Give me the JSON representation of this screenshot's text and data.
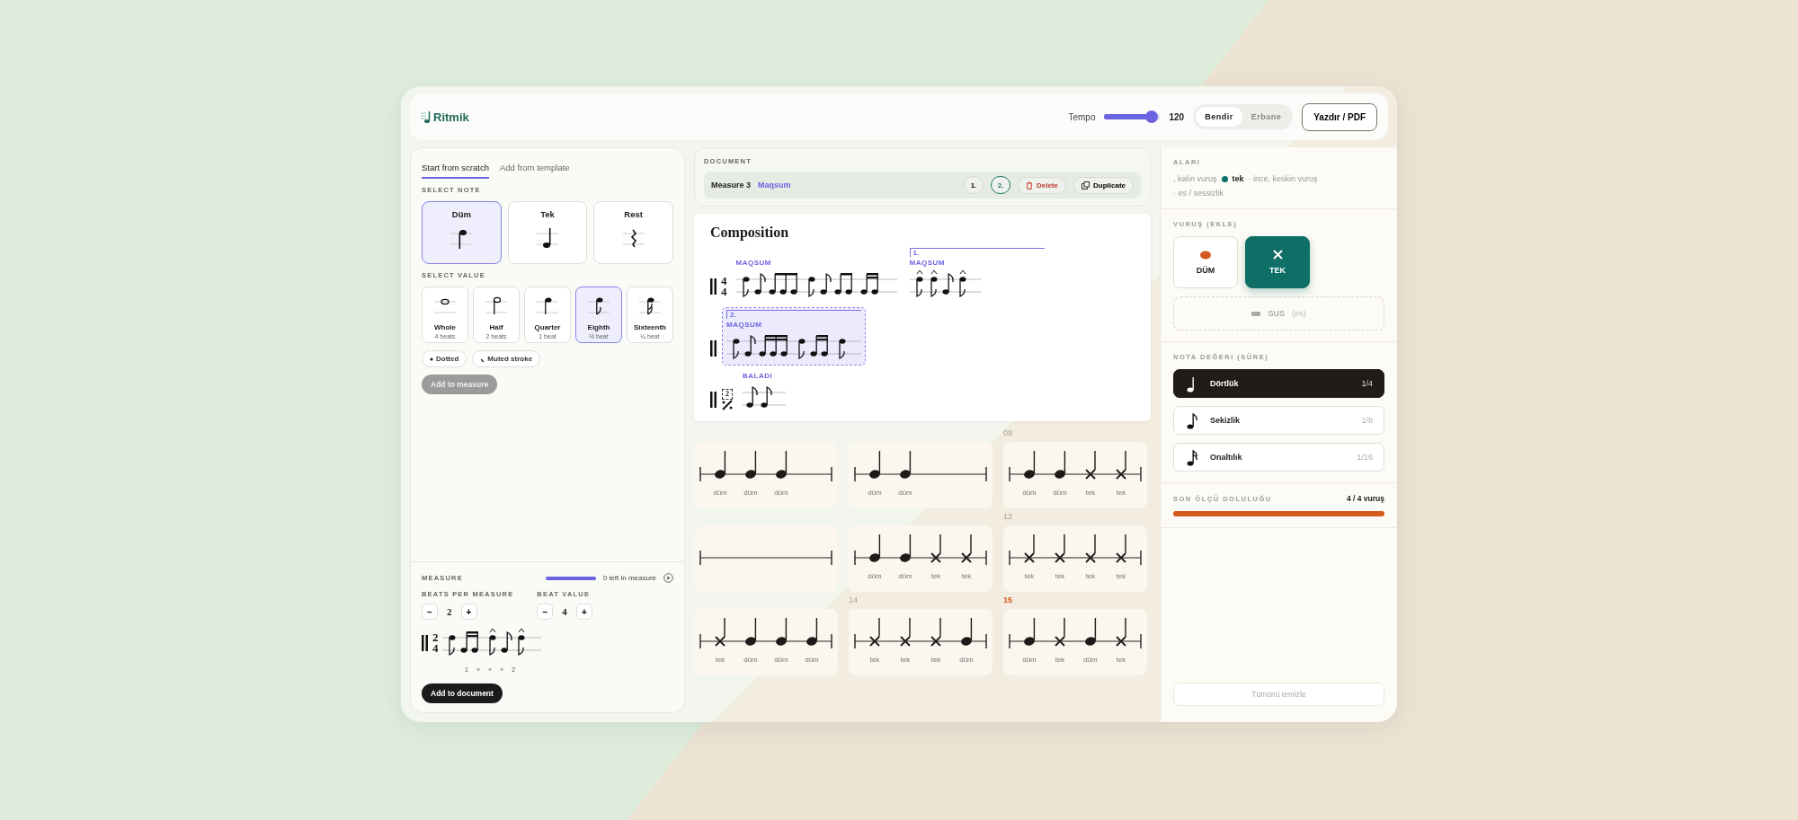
{
  "header": {
    "logo": "Ritmik",
    "tempo": {
      "label": "Tempo",
      "level": 0.95,
      "reading": "120"
    },
    "instruments": [
      {
        "label": "Bendir",
        "selected": true
      },
      {
        "label": "Erbane",
        "selected": false
      }
    ],
    "print_button": "Yazdır / PDF"
  },
  "builder": {
    "tabs": [
      {
        "label": "Start from scratch",
        "selected": true
      },
      {
        "label": "Add from template",
        "selected": false
      }
    ],
    "note_heading": "SELECT NOTE",
    "notes": [
      {
        "label": "Düm",
        "kind": "dum",
        "selected": true
      },
      {
        "label": "Tek",
        "kind": "tek",
        "selected": false
      },
      {
        "label": "Rest",
        "kind": "rest",
        "selected": false
      }
    ],
    "value_heading": "SELECT VALUE",
    "values": [
      {
        "label": "Whole",
        "beats": "4 beats",
        "kind": "whole",
        "selected": false
      },
      {
        "label": "Half",
        "beats": "2 beats",
        "kind": "half",
        "selected": false
      },
      {
        "label": "Quarter",
        "beats": "1 beat",
        "kind": "quarter",
        "selected": false
      },
      {
        "label": "Eighth",
        "beats": "½ beat",
        "kind": "eighth",
        "selected": true
      },
      {
        "label": "Sixteenth",
        "beats": "¼ beat",
        "kind": "sixteenth",
        "selected": false
      }
    ],
    "options": [
      {
        "label": "Dotted",
        "kind": "dotted"
      },
      {
        "label": "Muted stroke",
        "kind": "muted"
      }
    ],
    "add_button": {
      "label": "Add to measure",
      "disabled": true
    },
    "measure": {
      "heading": "MEASURE",
      "level": 1,
      "remaining": "0 left in measure",
      "steppers": [
        {
          "label": "BEATS PER MEASURE",
          "value": "2",
          "decrement": "−",
          "increment": "+"
        },
        {
          "label": "BEAT VALUE",
          "value": "4",
          "decrement": "−",
          "increment": "+"
        }
      ],
      "time_signature": [
        "2",
        "4"
      ],
      "counts": [
        "1",
        "+",
        "+",
        "+",
        "2"
      ]
    },
    "add_document_button": "Add to document"
  },
  "document": {
    "heading": "DOCUMENT",
    "toolbar": {
      "measure": "Measure 3",
      "rhythm": "Maqsum",
      "endings": [
        {
          "label": "1.",
          "selected": false
        },
        {
          "label": "2.",
          "selected": true
        }
      ],
      "delete": "Delete",
      "duplicate": "Duplicate"
    },
    "sheet": {
      "title": "Composition",
      "rows": [
        {
          "time_signature": [
            "4",
            "4"
          ],
          "segments": [
            {
              "label": "MAQSUM",
              "selected": false
            },
            {
              "label": "MAQSUM",
              "volta": "1.",
              "selected": false
            }
          ]
        },
        {
          "segments": [
            {
              "label": "MAQSUM",
              "volta": "2.",
              "selected": true
            }
          ]
        },
        {
          "repeat": "2",
          "segments": [
            {
              "label": "BALADI",
              "selected": false
            }
          ]
        }
      ]
    }
  },
  "measures": [
    {
      "strokes": [
        {
          "kind": "dum",
          "label": "düm"
        },
        {
          "kind": "dum",
          "label": "düm"
        },
        {
          "kind": "dum",
          "label": "düm"
        }
      ]
    },
    {
      "strokes": [
        {
          "kind": "dum",
          "label": "düm"
        },
        {
          "kind": "dum",
          "label": "düm"
        }
      ]
    },
    {
      "number": "09",
      "current": false,
      "strokes": [
        {
          "kind": "dum",
          "label": "düm"
        },
        {
          "kind": "dum",
          "label": "düm"
        },
        {
          "kind": "tek",
          "label": "tek"
        },
        {
          "kind": "tek",
          "label": "tek"
        }
      ]
    },
    {
      "empty": true
    },
    {
      "strokes": [
        {
          "kind": "dum",
          "label": "düm"
        },
        {
          "kind": "dum",
          "label": "düm"
        },
        {
          "kind": "tek",
          "label": "tek"
        },
        {
          "kind": "tek",
          "label": "tek"
        }
      ]
    },
    {
      "number": "12",
      "current": false,
      "strokes": [
        {
          "kind": "tek",
          "label": "tek"
        },
        {
          "kind": "tek",
          "label": "tek"
        },
        {
          "kind": "tek",
          "label": "tek"
        },
        {
          "kind": "tek",
          "label": "tek"
        }
      ]
    },
    {
      "strokes": [
        {
          "kind": "tek",
          "label": "tek"
        },
        {
          "kind": "dum",
          "label": "düm"
        },
        {
          "kind": "dum",
          "label": "düm"
        },
        {
          "kind": "dum",
          "label": "düm"
        }
      ]
    },
    {
      "number": "14",
      "current": false,
      "strokes": [
        {
          "kind": "tek",
          "label": "tek"
        },
        {
          "kind": "tek",
          "label": "tek"
        },
        {
          "kind": "tek",
          "label": "tek"
        },
        {
          "kind": "dum",
          "label": "düm"
        }
      ]
    },
    {
      "number": "15",
      "current": true,
      "strokes": [
        {
          "kind": "dum",
          "label": "düm"
        },
        {
          "kind": "tek",
          "label": "tek"
        },
        {
          "kind": "dum",
          "label": "düm"
        },
        {
          "kind": "tek",
          "label": "tek"
        }
      ]
    }
  ],
  "palette": {
    "legend": {
      "heading": "ALARI",
      "items": [
        {
          "text": ", kalın vuruş"
        },
        {
          "term": "tek",
          "text": "· ince, keskin vuruş",
          "color": "#0f6e66"
        },
        {
          "text": "· es / sessizlik"
        }
      ]
    },
    "stroke_heading": "VURUŞ (EKLE)",
    "strokes": [
      {
        "label": "DÜM",
        "kind": "dum",
        "selected": false
      },
      {
        "label": "TEK",
        "kind": "tek",
        "selected": true
      }
    ],
    "rest": {
      "label": "SUS",
      "hint": "(es)"
    },
    "value_heading": "NOTA DEĞERI (SÜRE)",
    "values": [
      {
        "label": "Dörtlük",
        "fraction": "1/4",
        "kind": "quarter",
        "selected": true
      },
      {
        "label": "Sekizlik",
        "fraction": "1/8",
        "kind": "eighth",
        "selected": false
      },
      {
        "label": "Onaltılık",
        "fraction": "1/16",
        "kind": "sixteenth",
        "selected": false
      }
    ],
    "fill": {
      "heading": "SON ÖLÇÜ DOLULUĞU",
      "reading": "4 / 4 vuruş",
      "level": 1
    },
    "clear_button": "Tümünü temizle"
  }
}
